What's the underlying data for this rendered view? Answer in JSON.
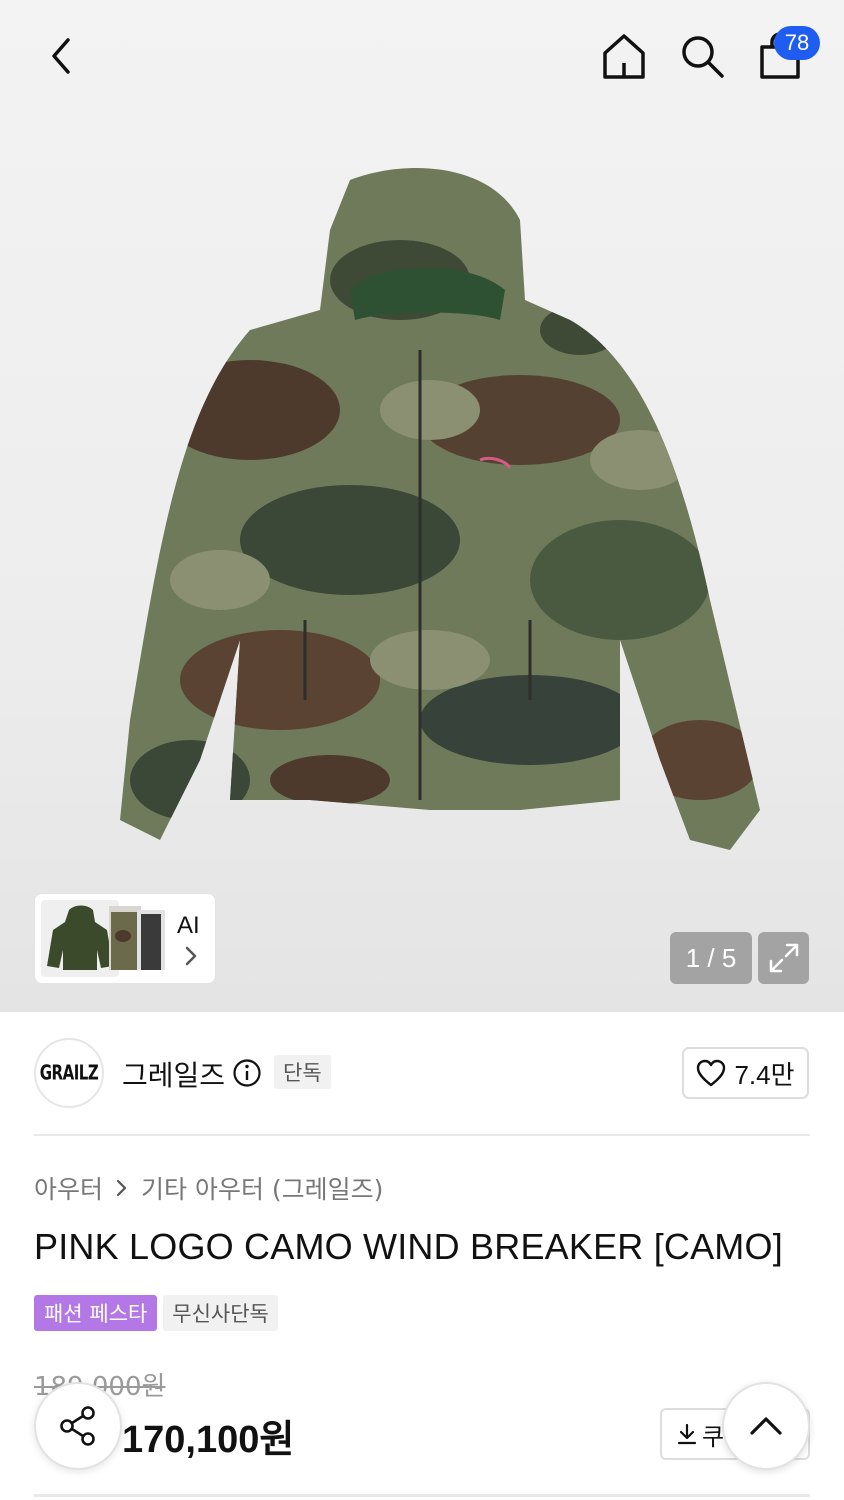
{
  "header": {
    "cart_count": "78"
  },
  "icons": {
    "back": "chevron-left-icon",
    "home": "home-icon",
    "search": "search-icon",
    "cart": "shopping-bag-icon",
    "expand": "expand-icon",
    "info": "info-icon",
    "like": "heart-icon",
    "download": "download-icon",
    "share": "share-icon",
    "scroll_top": "chevron-up-icon"
  },
  "gallery": {
    "thumb_label": "AI",
    "pager": "1 / 5"
  },
  "brand": {
    "logo_text": "GRAILZ",
    "name": "그레일즈",
    "tag": "단독",
    "like_count": "7.4만"
  },
  "breadcrumb": {
    "level1": "아우터",
    "level2": "기타 아우터 (그레일즈)"
  },
  "product": {
    "title": "PINK LOGO CAMO WIND BREAKER [CAMO]",
    "tags": [
      "패션 페스타",
      "무신사단독"
    ],
    "original_price": "189,000원",
    "sale_price": "170,100원",
    "coupon_label": "쿠"
  },
  "colors": {
    "accent_blue": "#1f5cf2",
    "festa_purple": "#b378e6"
  }
}
